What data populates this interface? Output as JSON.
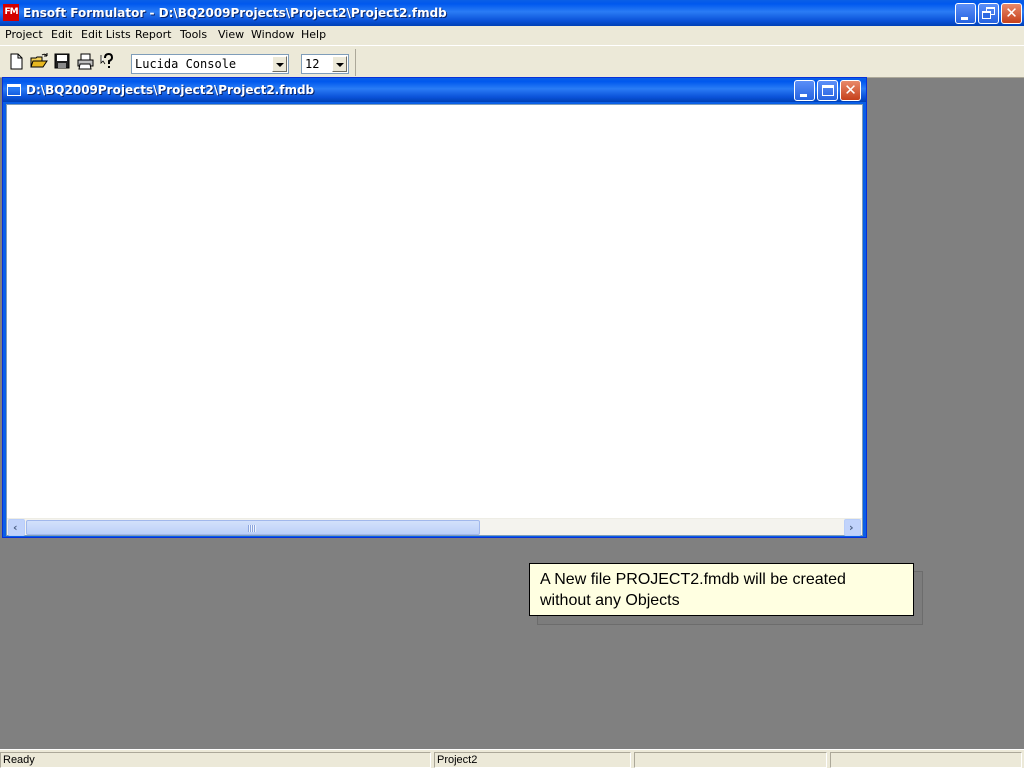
{
  "app": {
    "title": "Ensoft Formulator - D:\\BQ2009Projects\\Project2\\Project2.fmdb",
    "icon_label": "FM"
  },
  "menu": {
    "items": [
      "Project",
      "Edit",
      "Edit Lists",
      "Report",
      "Tools",
      "View",
      "Window",
      "Help"
    ]
  },
  "toolbar": {
    "buttons": [
      "new-icon",
      "open-icon",
      "save-icon",
      "print-icon",
      "help-icon"
    ],
    "font_name": "Lucida Console",
    "font_size": "12"
  },
  "child_window": {
    "title": "D:\\BQ2009Projects\\Project2\\Project2.fmdb"
  },
  "tooltip": {
    "line1": "A New file PROJECT2.fmdb will be created",
    "line2": "without any Objects"
  },
  "statusbar": {
    "status": "Ready",
    "project": "Project2",
    "pane3": "",
    "pane4": ""
  },
  "colors": {
    "titlebar": "#0058ee",
    "workspace": "#808080",
    "face": "#ece9d8",
    "tooltip_bg": "#ffffe1",
    "close_button": "#c6401c"
  }
}
